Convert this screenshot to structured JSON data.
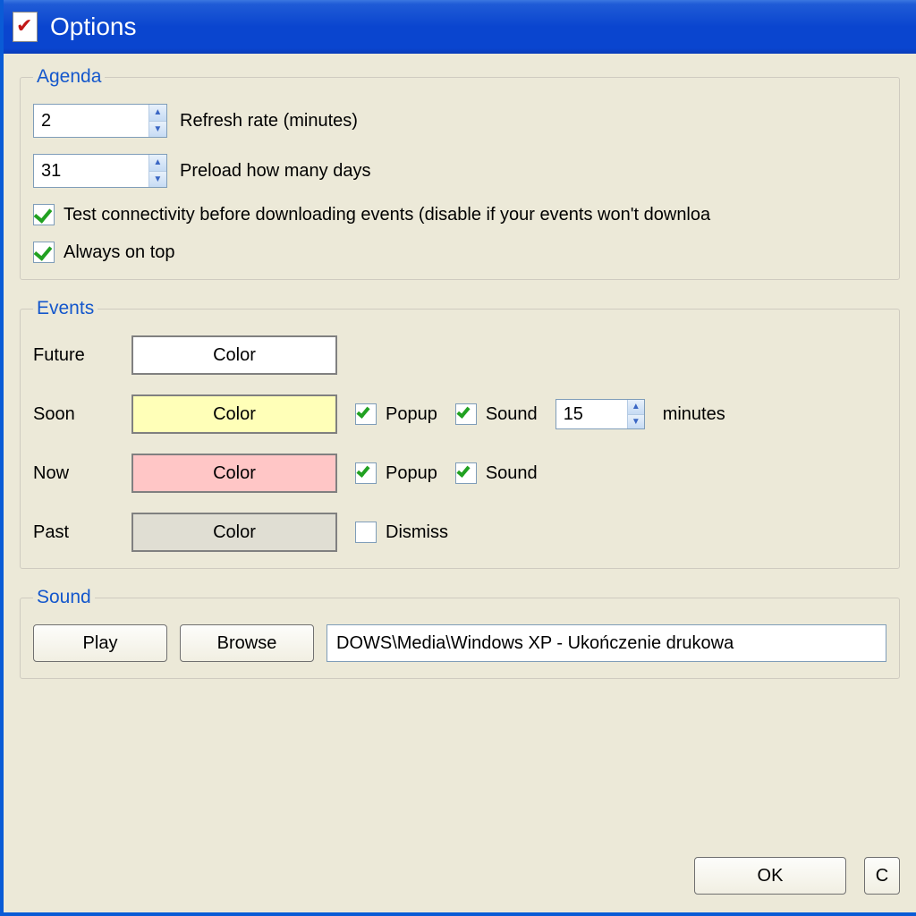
{
  "window": {
    "title": "Options"
  },
  "agenda": {
    "legend": "Agenda",
    "refresh_value": "2",
    "refresh_label": "Refresh rate (minutes)",
    "preload_value": "31",
    "preload_label": "Preload how many days",
    "test_conn_checked": true,
    "test_conn_label": "Test connectivity before downloading events (disable if your events won't downloa",
    "always_top_checked": true,
    "always_top_label": "Always on top"
  },
  "events": {
    "legend": "Events",
    "color_button_label": "Color",
    "rows": {
      "future": {
        "label": "Future",
        "swatch": "#FFFFFF"
      },
      "soon": {
        "label": "Soon",
        "swatch": "#FFFFB8",
        "popup_checked": true,
        "popup_label": "Popup",
        "sound_checked": true,
        "sound_label": "Sound",
        "minutes_value": "15",
        "minutes_unit": "minutes"
      },
      "now": {
        "label": "Now",
        "swatch": "#FFC6C6",
        "popup_checked": true,
        "popup_label": "Popup",
        "sound_checked": true,
        "sound_label": "Sound"
      },
      "past": {
        "label": "Past",
        "swatch": "#E0DED3",
        "dismiss_checked": false,
        "dismiss_label": "Dismiss"
      }
    }
  },
  "sound": {
    "legend": "Sound",
    "play_label": "Play",
    "browse_label": "Browse",
    "path_value": "DOWS\\Media\\Windows XP - Ukończenie drukowa"
  },
  "footer": {
    "ok_label": "OK",
    "cancel_label": "C"
  }
}
